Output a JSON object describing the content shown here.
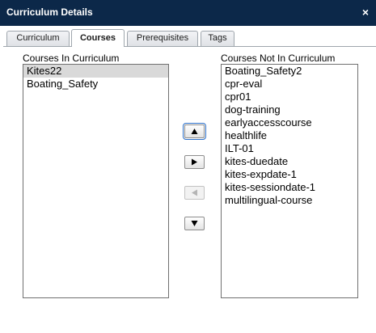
{
  "window": {
    "title": "Curriculum Details",
    "close_glyph": "×"
  },
  "tabs": [
    {
      "label": "Curriculum",
      "active": false
    },
    {
      "label": "Courses",
      "active": true
    },
    {
      "label": "Prerequisites",
      "active": false
    },
    {
      "label": "Tags",
      "active": false
    }
  ],
  "in_curriculum": {
    "label": "Courses In Curriculum",
    "items": [
      "Kites22",
      "Boating_Safety"
    ],
    "selected": "Kites22"
  },
  "not_in_curriculum": {
    "label": "Courses Not In Curriculum",
    "items": [
      "Boating_Safety2",
      "cpr-eval",
      "cpr01",
      "dog-training",
      "earlyaccesscourse",
      "healthlife",
      "ILT-01",
      "kites-duedate",
      "kites-expdate-1",
      "kites-sessiondate-1",
      "multilingual-course"
    ]
  },
  "buttons": {
    "move_up": {
      "icon": "up-arrow-icon",
      "enabled": true,
      "focused": true
    },
    "move_right": {
      "icon": "right-arrow-icon",
      "enabled": true
    },
    "move_left": {
      "icon": "left-arrow-icon",
      "enabled": false
    },
    "move_down": {
      "icon": "down-arrow-icon",
      "enabled": true
    }
  },
  "colors": {
    "titlebar": "#0c2849",
    "selected_row": "#d9d9d9",
    "arrow_enabled": "#000000",
    "arrow_disabled": "#b5b5b5"
  }
}
